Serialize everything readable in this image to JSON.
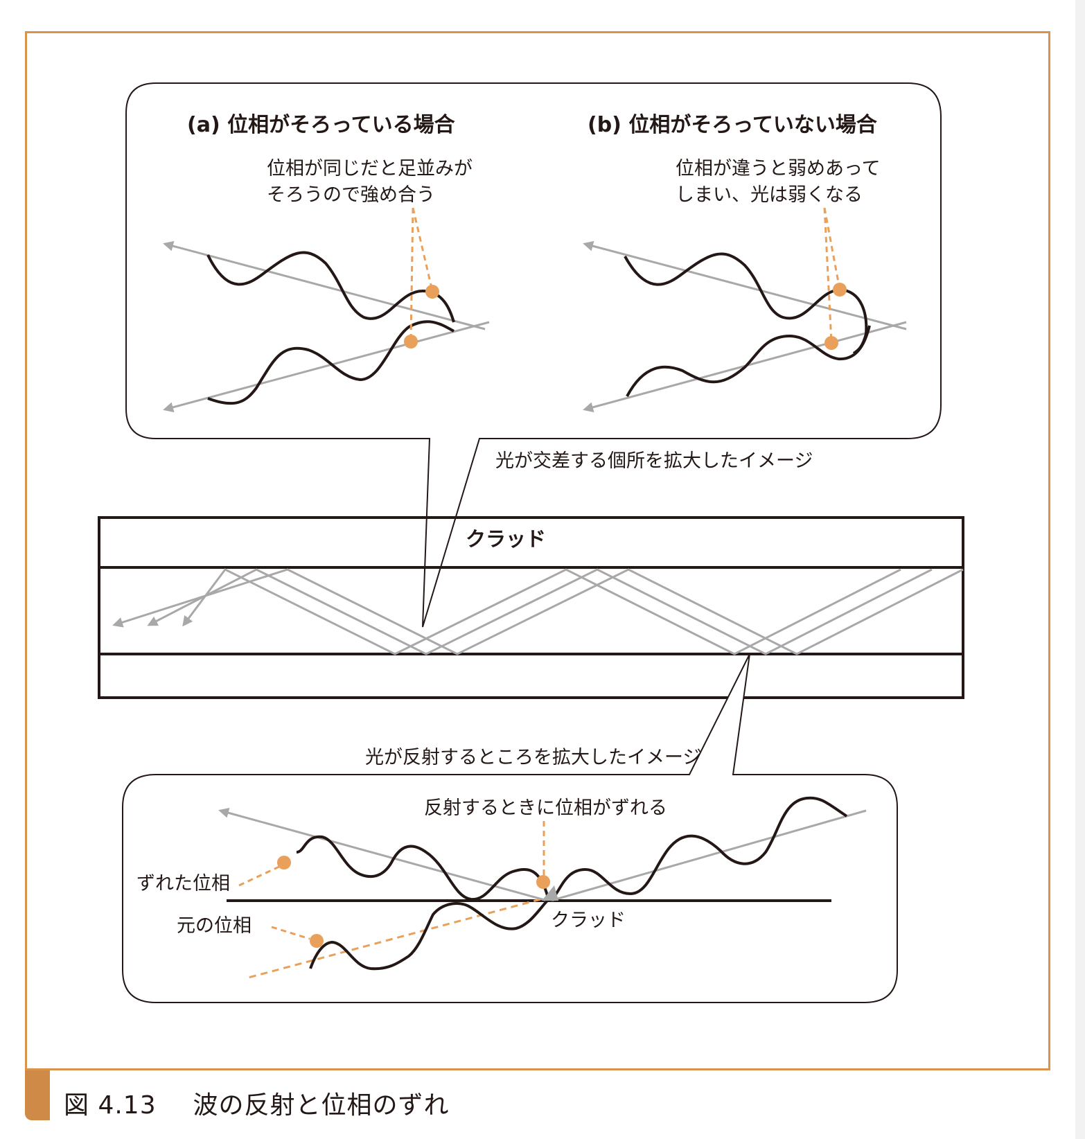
{
  "figure": {
    "number": "図 4.13",
    "title": "波の反射と位相のずれ"
  },
  "panels": {
    "a": {
      "title": "(a) 位相がそろっている場合",
      "note_line1": "位相が同じだと足並みが",
      "note_line2": "そろうので強め合う"
    },
    "b": {
      "title": "(b) 位相がそろっていない場合",
      "note_line1": "位相が違うと弱めあって",
      "note_line2": "しまい、光は弱くなる"
    }
  },
  "fiber": {
    "crossing_caption": "光が交差する個所を拡大したイメージ",
    "cladding_label": "クラッド",
    "reflection_caption": "光が反射するところを拡大したイメージ"
  },
  "reflection": {
    "title": "反射するときに位相がずれる",
    "shifted_phase": "ずれた位相",
    "original_phase": "元の位相",
    "cladding_label": "クラッド"
  },
  "colors": {
    "frame": "#d9934a",
    "accent": "#e8a05a",
    "ray": "#a8a8a8",
    "wave": "#231815"
  }
}
